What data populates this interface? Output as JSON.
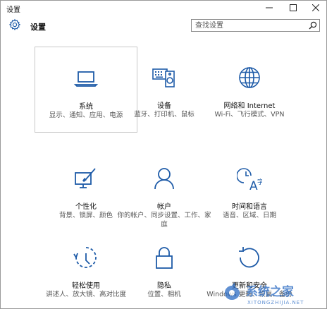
{
  "window": {
    "title": "设置"
  },
  "header": {
    "title": "设置",
    "search_placeholder": "查找设置"
  },
  "tiles": [
    {
      "name": "系统",
      "desc": "显示、通知、应用、电源",
      "icon": "laptop-icon"
    },
    {
      "name": "设备",
      "desc": "蓝牙、打印机、鼠标",
      "icon": "keyboard-speaker-icon"
    },
    {
      "name": "网络和 Internet",
      "desc": "Wi-Fi、飞行模式、VPN",
      "icon": "globe-icon"
    },
    {
      "name": "个性化",
      "desc": "背景、锁屏、颜色",
      "icon": "paintbrush-monitor-icon"
    },
    {
      "name": "帐户",
      "desc": "你的帐户、同步设置、工作、家庭",
      "icon": "person-icon"
    },
    {
      "name": "时间和语言",
      "desc": "语音、区域、日期",
      "icon": "clock-language-icon"
    },
    {
      "name": "轻松使用",
      "desc": "讲述人、放大镜、高对比度",
      "icon": "ease-of-access-icon"
    },
    {
      "name": "隐私",
      "desc": "位置、相机",
      "icon": "padlock-icon"
    },
    {
      "name": "更新和安全",
      "desc": "Windows 更新、恢复、备份",
      "icon": "refresh-icon"
    }
  ],
  "watermark": {
    "text": "系统之家",
    "url_text": "XITONGZHIJIA.NET"
  },
  "colors": {
    "accent": "#1e5ba8",
    "border": "#9a9a9a"
  }
}
